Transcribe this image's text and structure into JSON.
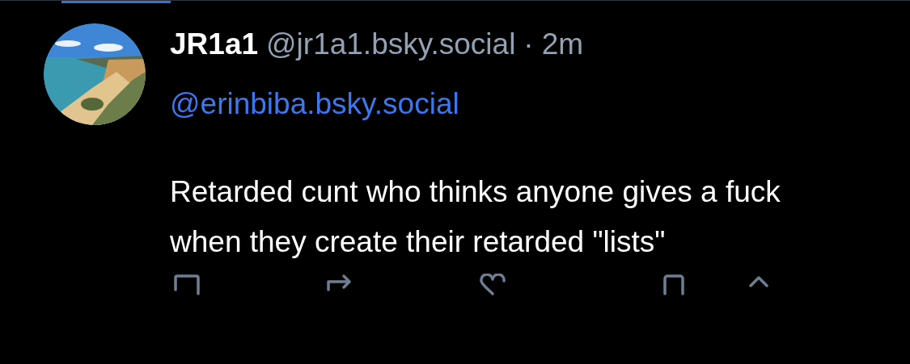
{
  "tabs": [
    {
      "selected": true
    }
  ],
  "post": {
    "author": "JR1a1",
    "handle": "@jr1a1.bsky.social",
    "separator": "·",
    "time": "2m",
    "mention": "@erinbiba.bsky.social",
    "text": "Retarded cunt who thinks anyone gives a fuck when they create their retarded \"lists\""
  }
}
